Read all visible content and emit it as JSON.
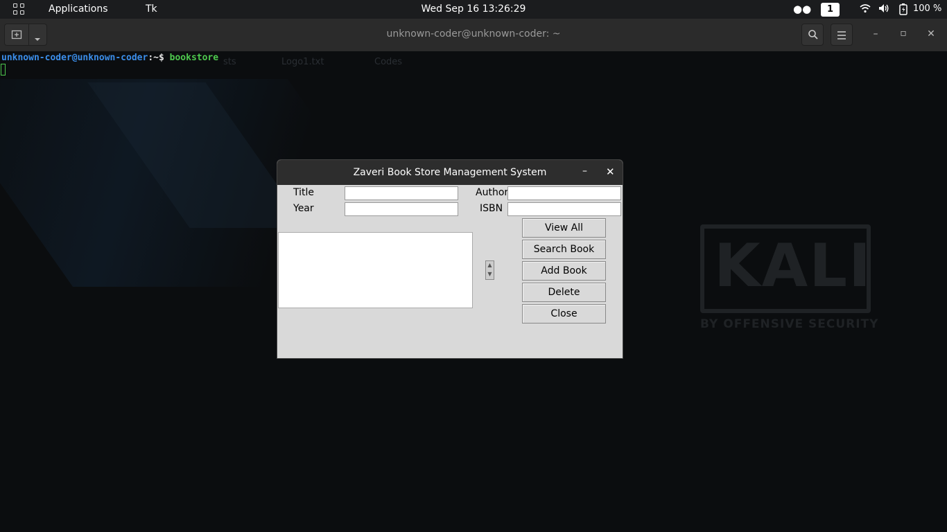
{
  "topbar": {
    "apps_label": "Applications",
    "active_app": "Tk",
    "clock": "Wed Sep 16  13:26:29",
    "workspace": "1",
    "battery": "100 %"
  },
  "terminal": {
    "title": "unknown-coder@unknown-coder: ~",
    "prompt_user": "unknown-coder@unknown-coder",
    "prompt_path": ":~$",
    "command": "bookstore"
  },
  "desktop": {
    "labels": [
      "sts",
      "Logo1.txt",
      "Codes"
    ],
    "kali_logo": "KALI",
    "kali_tagline": "BY OFFENSIVE SECURITY"
  },
  "dialog": {
    "title": "Zaveri Book Store Management System",
    "fields": {
      "title_label": "Title",
      "author_label": "Author",
      "year_label": "Year",
      "isbn_label": "ISBN",
      "title_value": "",
      "author_value": "",
      "year_value": "",
      "isbn_value": ""
    },
    "buttons": {
      "view_all": "View All",
      "search": "Search Book",
      "add": "Add Book",
      "delete": "Delete",
      "close": "Close"
    }
  }
}
